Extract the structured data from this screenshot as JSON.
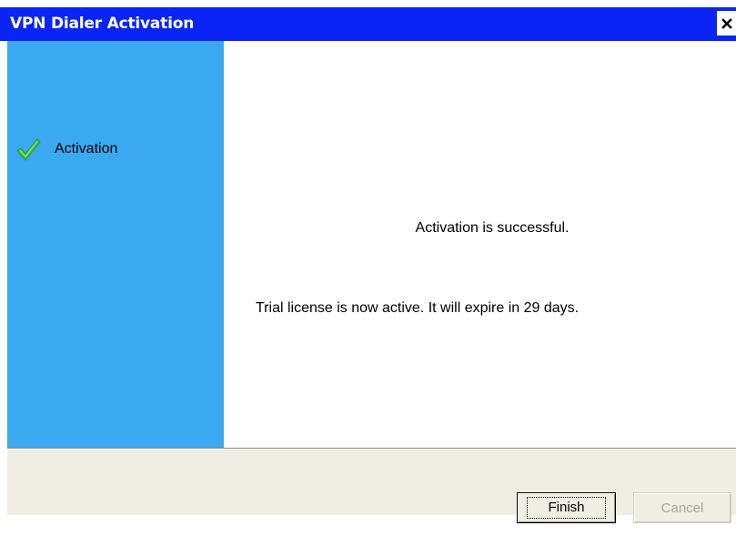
{
  "window": {
    "title": "VPN Dialer Activation",
    "close_label": "×"
  },
  "sidebar": {
    "steps": [
      {
        "label": "Activation",
        "icon": "checkmark-icon",
        "status": "completed"
      }
    ]
  },
  "content": {
    "primary_message": "Activation is successful.",
    "secondary_message": "Trial license is now active. It will expire in 29 days."
  },
  "footer": {
    "finish_label": "Finish",
    "cancel_label": "Cancel"
  },
  "colors": {
    "titlebar": "#0a24f5",
    "sidebar": "#3aa9f0",
    "footer": "#f0ede4",
    "check": "#3cc43c"
  }
}
